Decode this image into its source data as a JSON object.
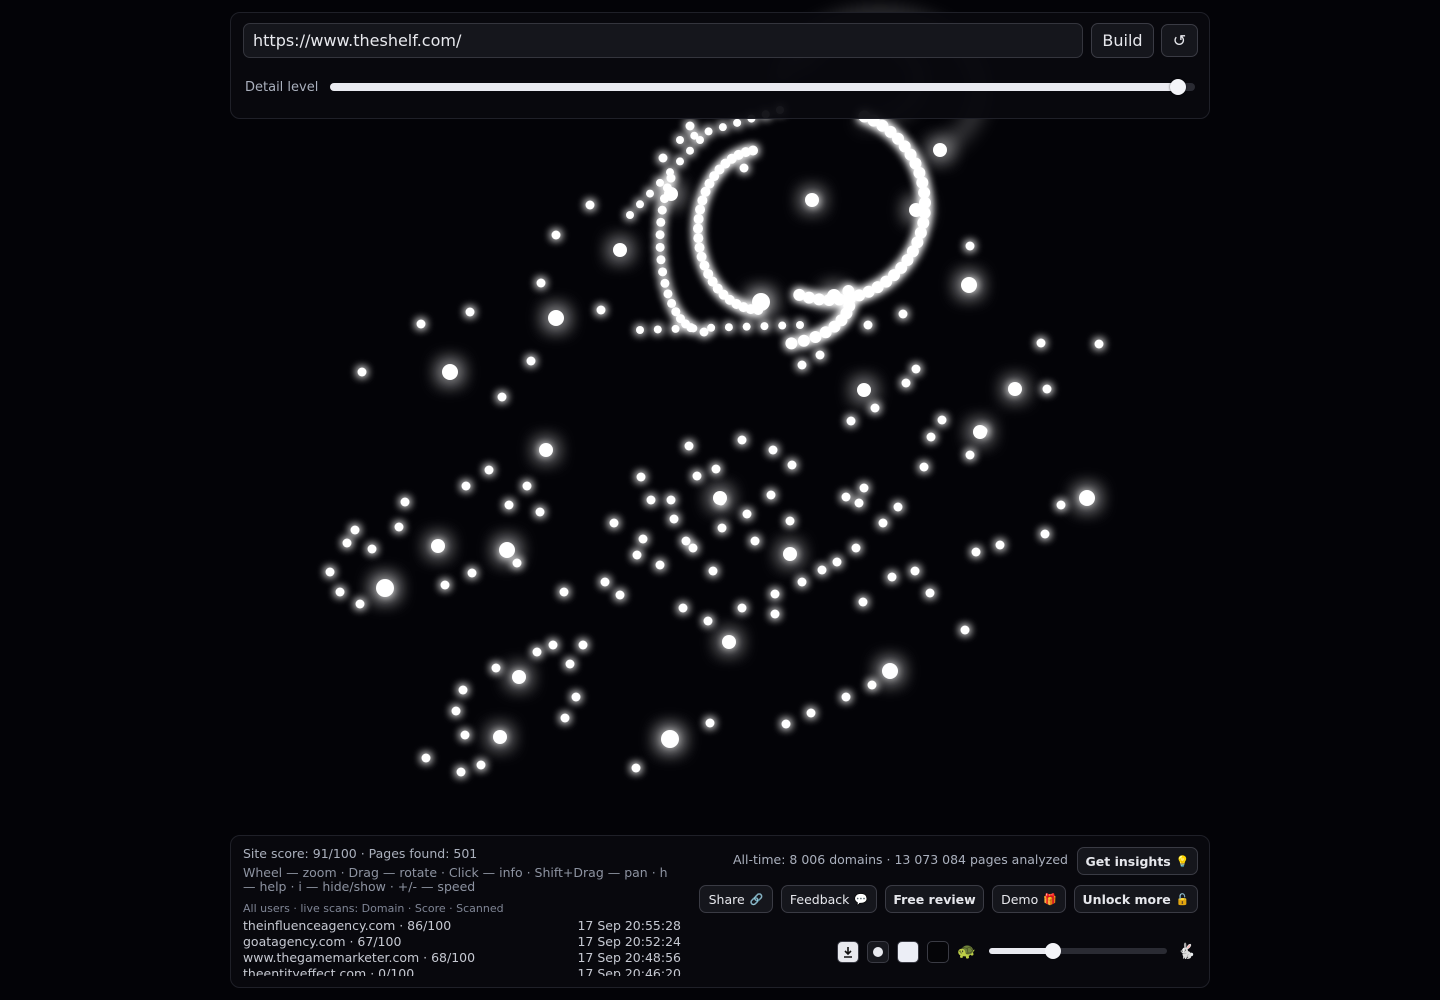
{
  "graph": {
    "node_color": "#ffffff",
    "background": "#030307"
  },
  "toolbar": {
    "url_value": "https://www.theshelf.com/",
    "build_label": "Build",
    "reload_icon": "↺",
    "detail_label": "Detail level",
    "detail_level": 0.98
  },
  "footer": {
    "stats": "Site score: 91/100 · Pages found: 501",
    "help": "Wheel — zoom · Drag — rotate · Click — info · Shift+Drag — pan · h — help · i — hide/show · +/- — speed",
    "live_header": "All users · live scans: Domain · Score · Scanned",
    "live_rows": [
      {
        "domain": "theinfluenceagency.com · 86/100",
        "time": "17 Sep 20:55:28"
      },
      {
        "domain": "goatagency.com · 67/100",
        "time": "17 Sep 20:52:24"
      },
      {
        "domain": "www.thegamemarketer.com · 68/100",
        "time": "17 Sep 20:48:56"
      },
      {
        "domain": "theentityeffect.com · 0/100",
        "time": "17 Sep 20:46:20"
      }
    ],
    "alltime": "All-time: 8 006 domains · 13 073 084 pages analyzed",
    "insights_label": "Get insights",
    "insights_icon": "💡",
    "share_label": "Share",
    "share_icon": "🔗",
    "feedback_label": "Feedback",
    "feedback_icon": "💬",
    "review_label": "Free review",
    "demo_label": "Demo",
    "demo_icon": "🎁",
    "unlock_label": "Unlock more",
    "unlock_icon": "🔓",
    "turtle_icon": "🐢",
    "rabbit_icon": "🐇",
    "speed_level": 0.36
  }
}
